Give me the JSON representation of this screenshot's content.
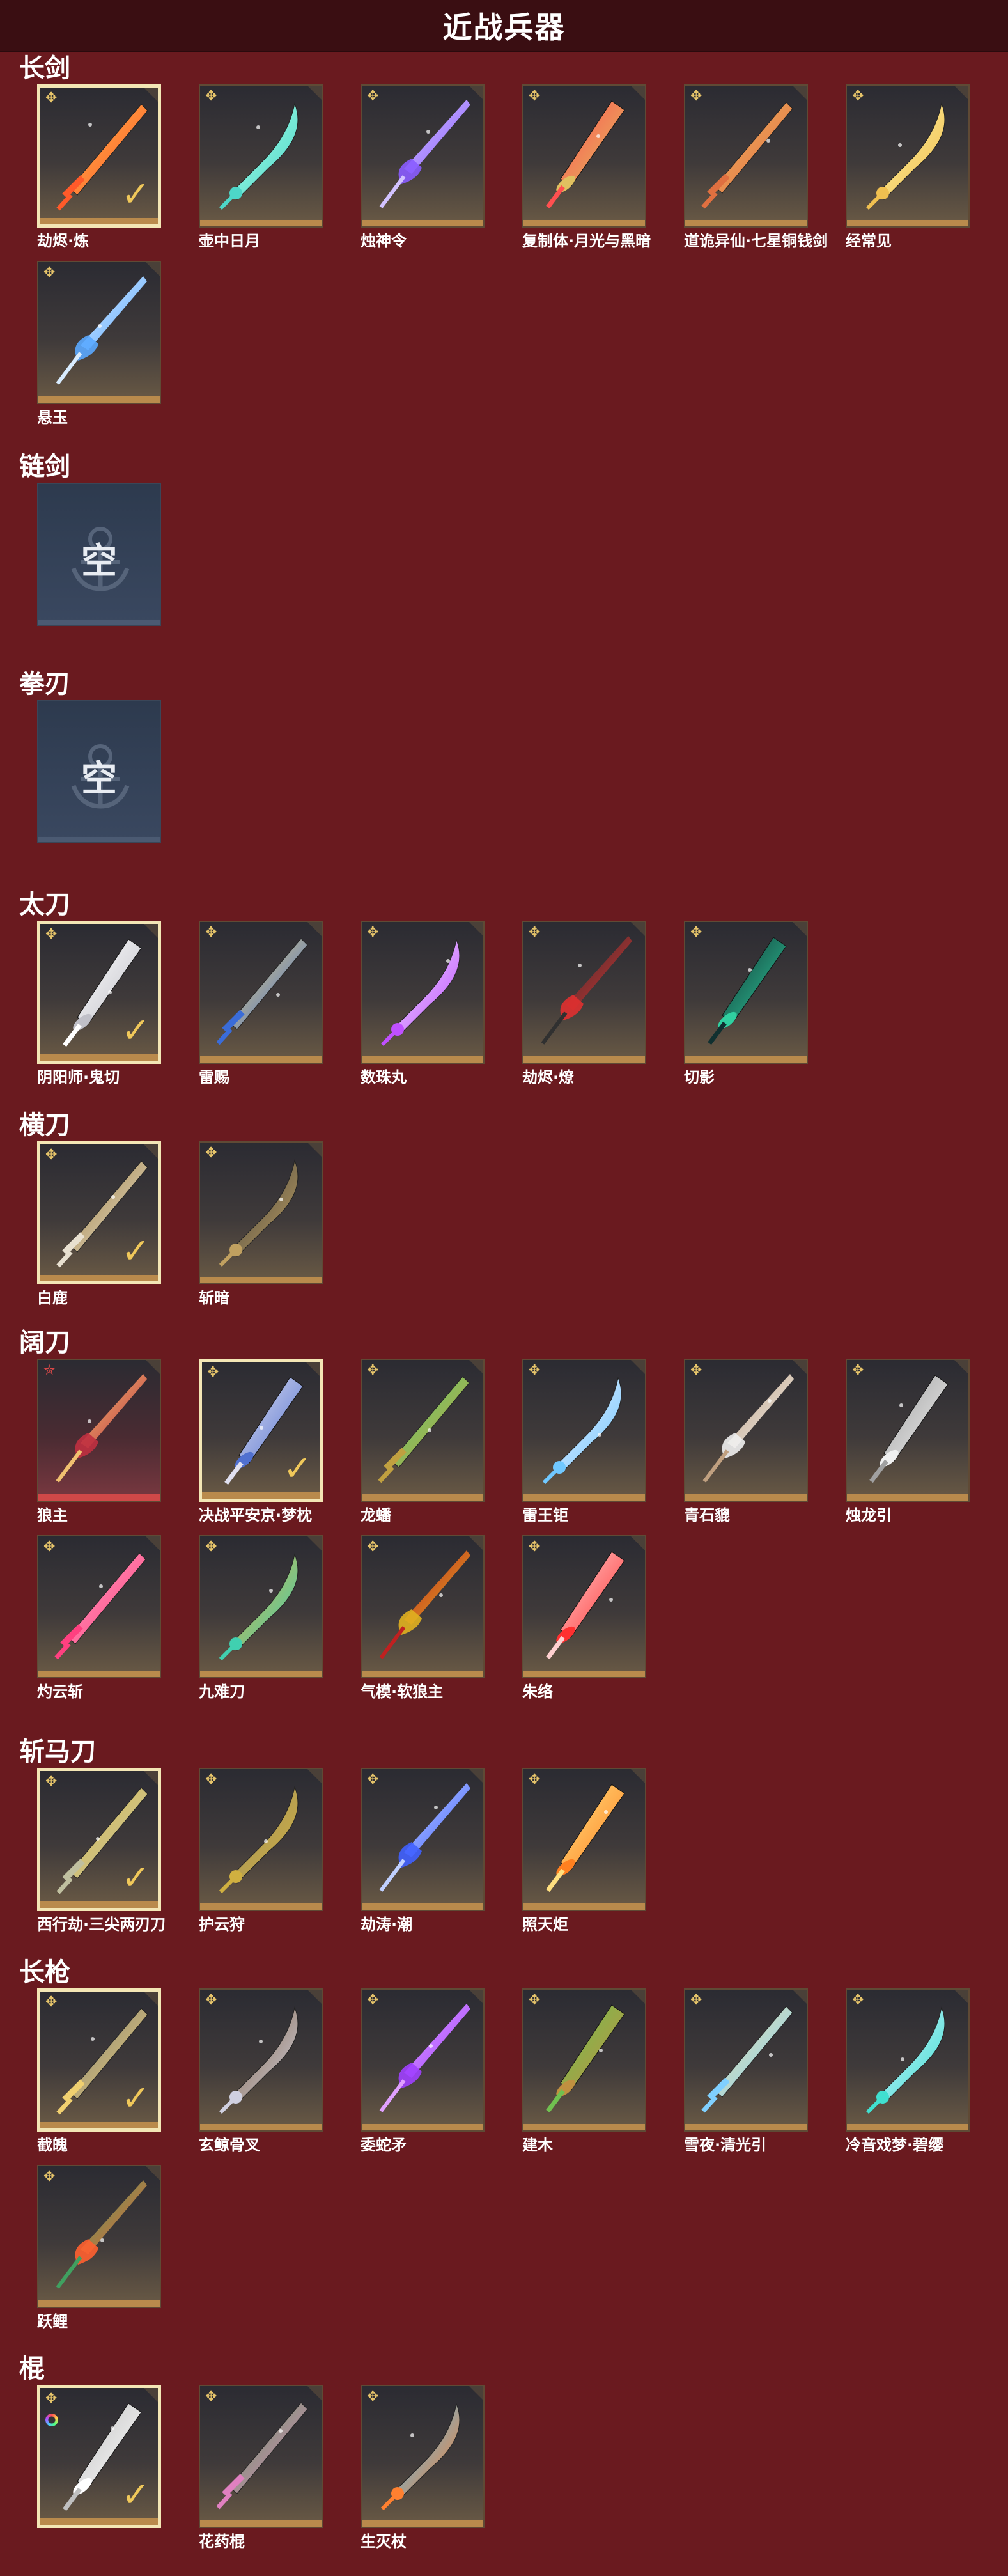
{
  "header": {
    "title": "近战兵器"
  },
  "empty_label": "空",
  "colors": {
    "background": "#6a1a1f",
    "header": "#3a0e12",
    "tile_frame_bottom": "#b98a4c",
    "selected_border": "#f3e6b5",
    "check": "#f0c85a"
  },
  "sections": [
    {
      "name": "长剑",
      "items": [
        {
          "label": "劫烬·炼",
          "selected": true,
          "icon": "sword-red-icon"
        },
        {
          "label": "壶中日月",
          "selected": false,
          "icon": "sword-teal-icon"
        },
        {
          "label": "烛神令",
          "selected": false,
          "icon": "sword-purple-icon"
        },
        {
          "label": "复制体·月光与黑暗",
          "selected": false,
          "icon": "sword-gold-ring-icon"
        },
        {
          "label": "道诡异仙·七星铜钱剑",
          "selected": false,
          "icon": "coin-sword-icon"
        },
        {
          "label": "经常见",
          "selected": false,
          "icon": "sword-gold-icon"
        },
        {
          "label": "悬玉",
          "selected": false,
          "icon": "sword-blue-icon"
        }
      ]
    },
    {
      "name": "链剑",
      "items": [],
      "empty": true
    },
    {
      "name": "拳刃",
      "items": [],
      "empty": true
    },
    {
      "name": "太刀",
      "items": [
        {
          "label": "阴阳师·鬼切",
          "selected": true,
          "icon": "twin-katana-icon"
        },
        {
          "label": "雷赐",
          "selected": false,
          "icon": "katana-blue-icon"
        },
        {
          "label": "数珠丸",
          "selected": false,
          "icon": "katana-purple-icon"
        },
        {
          "label": "劫烬·燎",
          "selected": false,
          "icon": "katana-red-icon"
        },
        {
          "label": "切影",
          "selected": false,
          "icon": "katana-green-icon"
        }
      ]
    },
    {
      "name": "横刀",
      "items": [
        {
          "label": "白鹿",
          "selected": true,
          "icon": "saber-white-icon"
        },
        {
          "label": "斩暗",
          "selected": false,
          "icon": "saber-dark-icon"
        }
      ]
    },
    {
      "name": "阔刀",
      "items": [
        {
          "label": "狼主",
          "selected": false,
          "red": true,
          "icon": "broadblade-red-icon"
        },
        {
          "label": "决战平安京·梦枕",
          "selected": true,
          "icon": "scroll-blade-icon"
        },
        {
          "label": "龙蟠",
          "selected": false,
          "icon": "broadblade-gold-icon"
        },
        {
          "label": "雷王钜",
          "selected": false,
          "icon": "broadblade-ice-icon"
        },
        {
          "label": "青石貔",
          "selected": false,
          "icon": "broadblade-white-icon"
        },
        {
          "label": "烛龙引",
          "selected": false,
          "icon": "broadblade-silver-icon"
        },
        {
          "label": "灼云斩",
          "selected": false,
          "icon": "broadblade-pink-icon"
        },
        {
          "label": "九难刀",
          "selected": false,
          "icon": "broadblade-jade-icon"
        },
        {
          "label": "气模·软狼主",
          "selected": false,
          "icon": "broadblade-crimson-gold-icon"
        },
        {
          "label": "朱络",
          "selected": false,
          "icon": "broadblade-crimson-icon"
        }
      ]
    },
    {
      "name": "斩马刀",
      "items": [
        {
          "label": "西行劫·三尖两刃刀",
          "selected": true,
          "icon": "trident-blade-icon"
        },
        {
          "label": "护云狩",
          "selected": false,
          "icon": "glaive-gold-icon"
        },
        {
          "label": "劫涛·潮",
          "selected": false,
          "icon": "glaive-blue-icon"
        },
        {
          "label": "照天炬",
          "selected": false,
          "icon": "glaive-fire-icon"
        }
      ]
    },
    {
      "name": "长枪",
      "items": [
        {
          "label": "截魄",
          "selected": true,
          "icon": "spear-gold-icon"
        },
        {
          "label": "玄鲸骨叉",
          "selected": false,
          "icon": "spear-silver-icon"
        },
        {
          "label": "委蛇矛",
          "selected": false,
          "icon": "spear-purple-icon"
        },
        {
          "label": "建木",
          "selected": false,
          "icon": "spear-wood-icon"
        },
        {
          "label": "雪夜·清光引",
          "selected": false,
          "icon": "spear-ice-icon"
        },
        {
          "label": "冷音戏梦·碧缨",
          "selected": false,
          "icon": "spear-jade-icon"
        },
        {
          "label": "跃鲤",
          "selected": false,
          "icon": "spear-carp-icon"
        }
      ]
    },
    {
      "name": "棍",
      "items": [
        {
          "label": "",
          "selected": true,
          "rainbow": true,
          "icon": "staff-white-icon"
        },
        {
          "label": "花药棍",
          "selected": false,
          "icon": "staff-flower-icon"
        },
        {
          "label": "生灭杖",
          "selected": false,
          "icon": "staff-fire-icon"
        }
      ]
    }
  ]
}
